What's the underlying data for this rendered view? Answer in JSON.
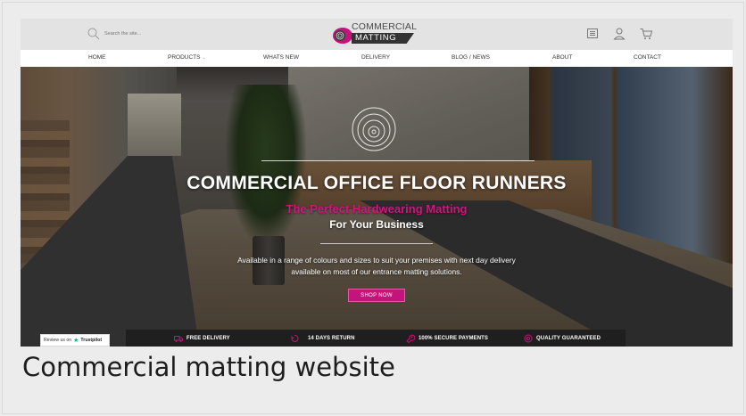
{
  "search": {
    "placeholder": "Search the site..."
  },
  "logo": {
    "line1": "COMMERCIAL",
    "line2": "MATTING"
  },
  "header_icons": [
    "catalogue-icon",
    "account-icon",
    "cart-icon"
  ],
  "nav": {
    "items": [
      {
        "label": "HOME"
      },
      {
        "label": "PRODUCTS",
        "has_dropdown": true,
        "arrow": "⌄"
      },
      {
        "label": "WHATS NEW"
      },
      {
        "label": "DELIVERY"
      },
      {
        "label": "BLOG / NEWS"
      },
      {
        "label": "ABOUT"
      },
      {
        "label": "CONTACT"
      }
    ]
  },
  "hero": {
    "title": "COMMERCIAL OFFICE FLOOR RUNNERS",
    "subtitle_accent": "The Perfect Hardwearing Matting",
    "subtitle": "For Your Business",
    "description": "Available in a range of colours and sizes to suit your premises with next day delivery available on most of our entrance matting solutions.",
    "cta": "SHOP NOW"
  },
  "trustpilot": {
    "prefix": "Review us on",
    "star": "★",
    "brand": "Trustpilot"
  },
  "features": [
    {
      "icon": "truck-icon",
      "label": "FREE DELIVERY"
    },
    {
      "icon": "return-icon",
      "label": "14 DAYS RETURN"
    },
    {
      "icon": "secure-icon",
      "label": "100% SECURE PAYMENTS"
    },
    {
      "icon": "quality-icon",
      "label": "QUALITY GUARANTEED"
    }
  ],
  "caption": "Commercial matting website",
  "colors": {
    "brand_pink": "#c4137a",
    "accent_text": "#d0157f",
    "header_bg": "#e3e3e3",
    "feature_bar": "#1f1f1f"
  }
}
